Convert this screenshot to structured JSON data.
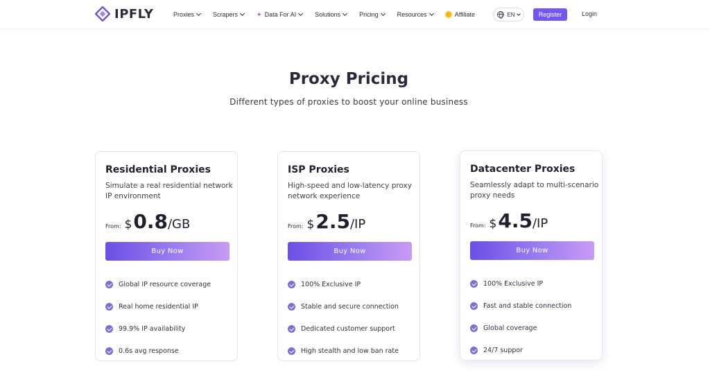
{
  "nav": {
    "logo_text": "IPFLY",
    "menu": [
      {
        "label": "Proxies",
        "has_dropdown": true
      },
      {
        "label": "Scrapers",
        "has_dropdown": true
      },
      {
        "label": "Data For AI",
        "has_dropdown": true,
        "icon": "sparkle-icon"
      },
      {
        "label": "Solutions",
        "has_dropdown": true
      },
      {
        "label": "Pricing",
        "has_dropdown": true
      },
      {
        "label": "Resources",
        "has_dropdown": true
      },
      {
        "label": "Affiliate",
        "has_dropdown": false,
        "icon": "sun-icon"
      }
    ],
    "language": "EN",
    "register_label": "Register",
    "login_label": "Login"
  },
  "hero": {
    "title": "Proxy Pricing",
    "subtitle": "Different types of proxies to boost your online business"
  },
  "plans": [
    {
      "title": "Residential Proxies",
      "description": "Simulate a real residential network IP environment",
      "from_label": "From:",
      "currency": "$",
      "amount": "0.8",
      "unit": "/GB",
      "button_label": "Buy Now",
      "features": [
        "Global IP resource coverage",
        "Real home residential IP",
        "99.9% IP availability",
        "0.6s avg response"
      ]
    },
    {
      "title": "ISP Proxies",
      "description": "High-speed and low-latency proxy network experience",
      "from_label": "From:",
      "currency": "$",
      "amount": "2.5",
      "unit": "/IP",
      "button_label": "Buy Now",
      "features": [
        "100% Exclusive IP",
        "Stable and secure connection",
        "Dedicated customer support",
        "High stealth and low ban rate"
      ]
    },
    {
      "title": "Datacenter Proxies",
      "description": "Seamlessly adapt to multi-scenario proxy needs",
      "from_label": "From:",
      "currency": "$",
      "amount": "4.5",
      "unit": "/IP",
      "button_label": "Buy Now",
      "features": [
        "100% Exclusive IP",
        "Fast and stable connection",
        "Global coverage",
        "24/7 suppor"
      ]
    }
  ],
  "colors": {
    "accent": "#7357f0",
    "gradient_start": "#6a4fe6",
    "gradient_end": "#c99af5",
    "check": "#7f6bd9"
  }
}
